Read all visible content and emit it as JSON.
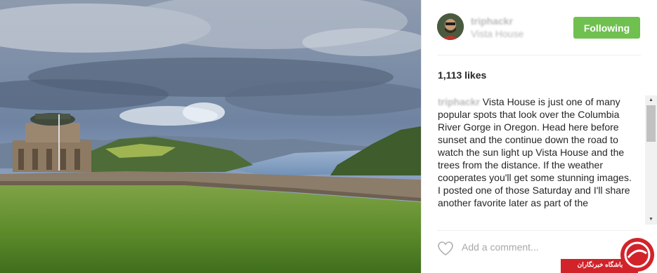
{
  "post": {
    "username": "triphackr",
    "location": "Vista House",
    "follow_button": "Following",
    "likes": "1,113 likes",
    "caption_username": "triphackr",
    "caption_text": " Vista House is just one of many popular spots that look over the Columbia River Gorge in Oregon. Head here before sunset and the continue down the road to watch the sun light up Vista House and the trees from the distance. If the weather cooperates you'll get some stunning images.",
    "caption_text_2": "I posted one of those Saturday and I'll share another favorite later as part of the",
    "comment_placeholder": "Add a comment..."
  },
  "watermark": {
    "text": "باشگاه خبرنگاران",
    "color": "#d2232a"
  },
  "colors": {
    "follow_green": "#70c050",
    "text": "#262626"
  }
}
